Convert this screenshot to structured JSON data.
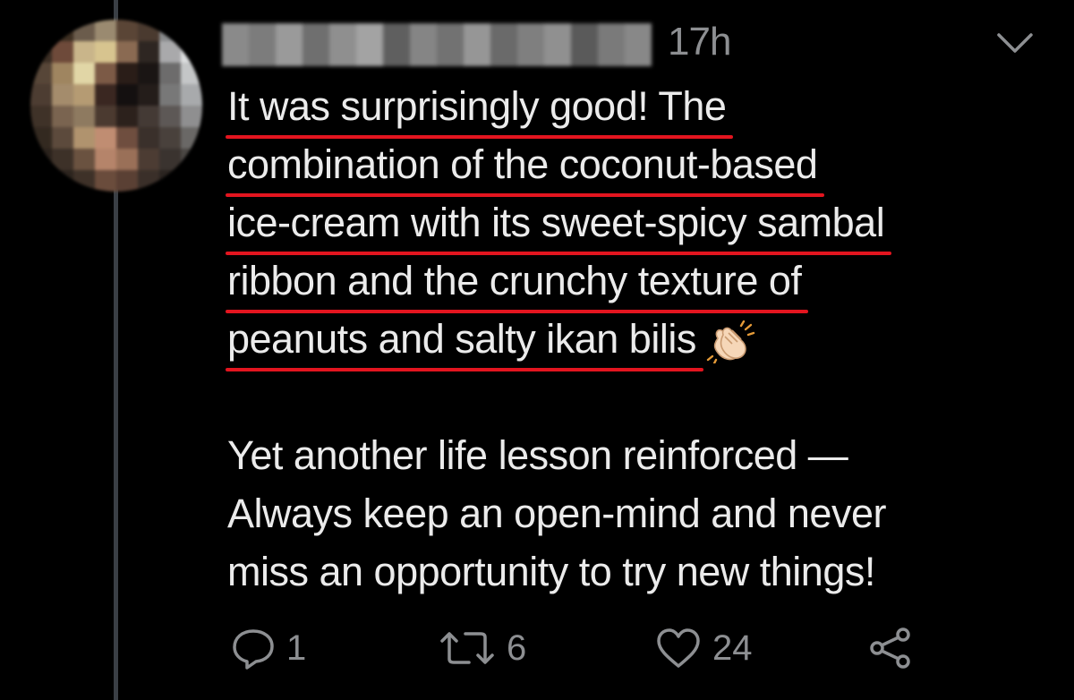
{
  "tweet": {
    "timestamp": "17h",
    "lines": [
      "It was surprisingly good! The",
      "combination of the coconut-based",
      "ice-cream with its sweet-spicy sambal",
      "ribbon and the crunchy texture of",
      "peanuts and salty ikan bilis"
    ],
    "emoji": "clapping-hands",
    "paragraph2": [
      "Yet another life lesson reinforced —",
      "Always keep an open-mind and never",
      "miss an opportunity to try new things!"
    ]
  },
  "actions": {
    "reply_count": "1",
    "retweet_count": "6",
    "like_count": "24"
  },
  "colors": {
    "background": "#000000",
    "text": "#ebebeb",
    "muted": "#8d8f92",
    "highlight_underline": "#e3151f",
    "thread_line": "#3a3f45"
  },
  "icons": [
    "reply-icon",
    "retweet-icon",
    "like-icon",
    "share-icon",
    "chevron-down-icon"
  ]
}
